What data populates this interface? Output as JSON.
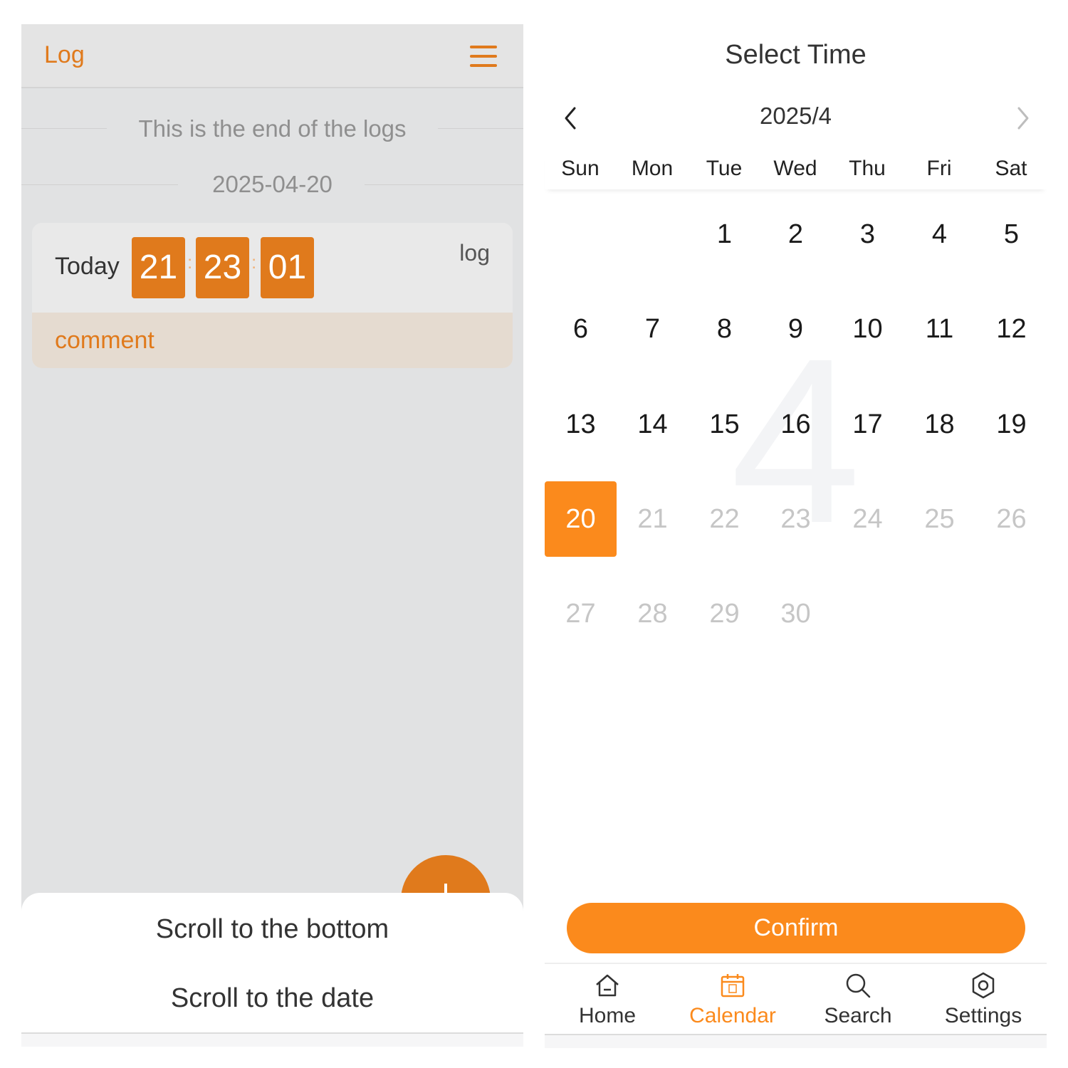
{
  "log_screen": {
    "header": {
      "title": "Log"
    },
    "end_of_logs": "This is the end of the logs",
    "date_separator": "2025-04-20",
    "entry": {
      "day_label": "Today",
      "hour": "21",
      "minute": "23",
      "second": "01",
      "colon": ":",
      "tag": "log",
      "comment": "comment"
    },
    "sheet": {
      "scroll_bottom": "Scroll to the bottom",
      "scroll_date": "Scroll to the date"
    },
    "accent_color": "#e07a1c"
  },
  "picker": {
    "title": "Select Time",
    "month_label": "2025/4",
    "watermark": "4",
    "weekdays": [
      "Sun",
      "Mon",
      "Tue",
      "Wed",
      "Thu",
      "Fri",
      "Sat"
    ],
    "weeks": [
      [
        "",
        "",
        "1",
        "2",
        "3",
        "4",
        "5"
      ],
      [
        "6",
        "7",
        "8",
        "9",
        "10",
        "11",
        "12"
      ],
      [
        "13",
        "14",
        "15",
        "16",
        "17",
        "18",
        "19"
      ],
      [
        "20",
        "21",
        "22",
        "23",
        "24",
        "25",
        "26"
      ],
      [
        "27",
        "28",
        "29",
        "30",
        "",
        "",
        ""
      ]
    ],
    "selected_day": "20",
    "confirm_label": "Confirm",
    "accent_color": "#fb8a1c"
  },
  "tabbar": {
    "tabs": [
      {
        "label": "Home",
        "icon": "home-icon"
      },
      {
        "label": "Calendar",
        "icon": "calendar-icon",
        "active": true
      },
      {
        "label": "Search",
        "icon": "search-icon"
      },
      {
        "label": "Settings",
        "icon": "gear-icon"
      }
    ]
  }
}
